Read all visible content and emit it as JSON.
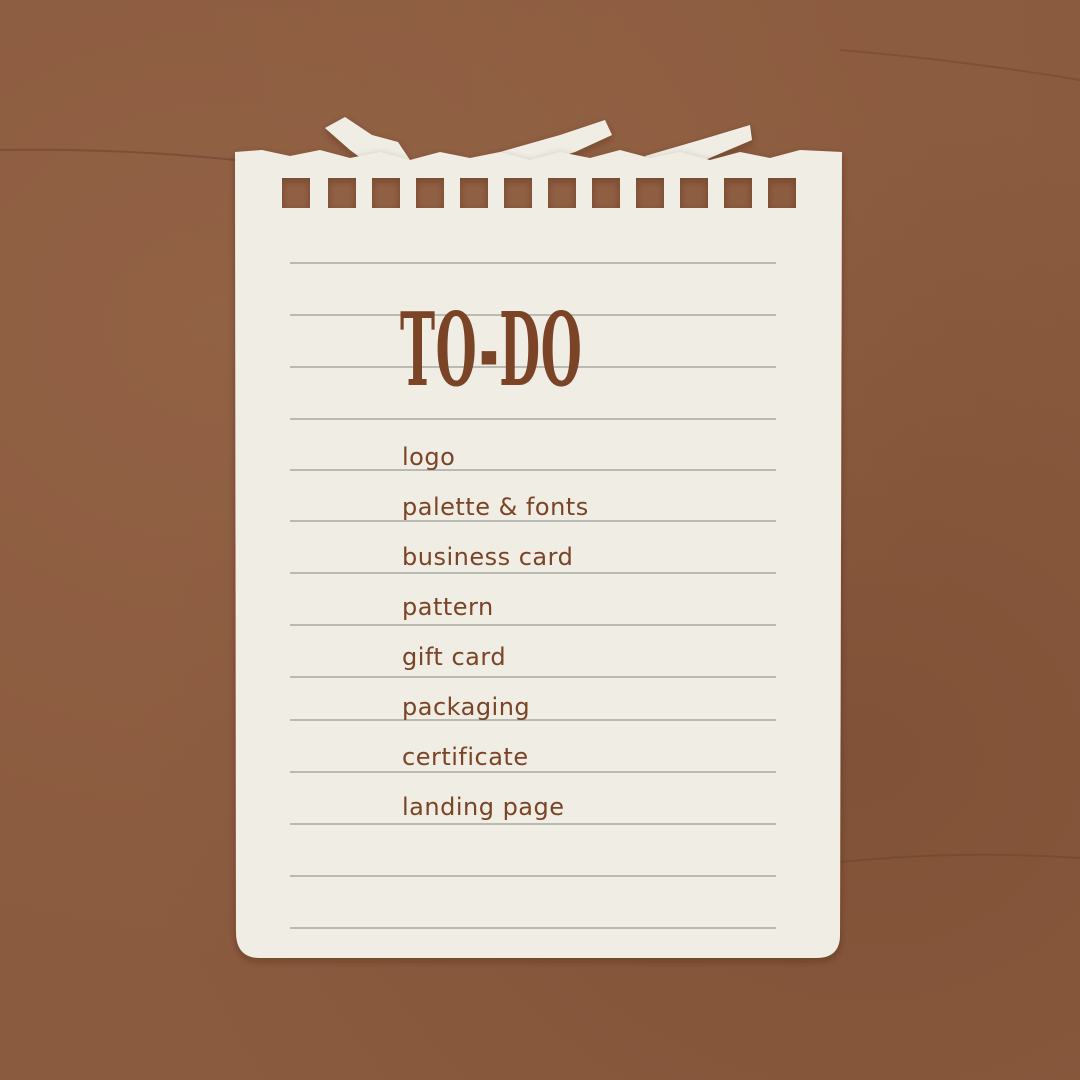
{
  "note": {
    "title": "TO-DO",
    "items": [
      "logo",
      "palette & fonts",
      "business card",
      "pattern",
      "gift card",
      "packaging",
      "certificate",
      "landing page"
    ]
  },
  "colors": {
    "background": "#8b5b3f",
    "paper": "#efede4",
    "ink": "#7b4427",
    "rule_line": "#9a9a95"
  }
}
